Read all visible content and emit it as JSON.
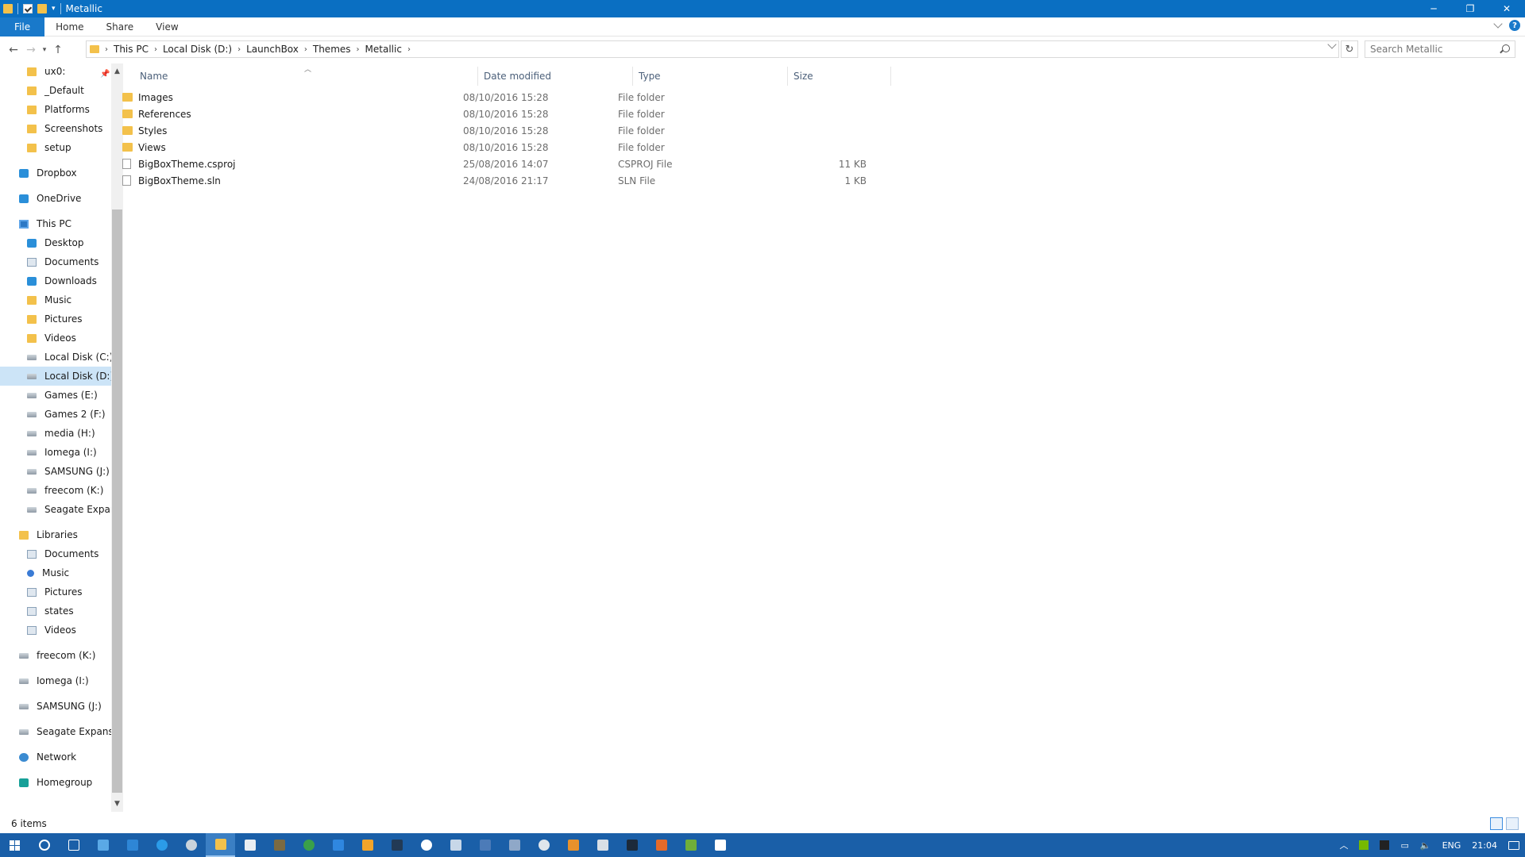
{
  "window": {
    "title": "Metallic",
    "controls": {
      "minimize": "─",
      "restore": "❐",
      "close": "✕"
    }
  },
  "ribbon": {
    "tabs": [
      {
        "label": "File"
      },
      {
        "label": "Home"
      },
      {
        "label": "Share"
      },
      {
        "label": "View"
      }
    ],
    "help": "?"
  },
  "address": {
    "crumbs": [
      "This PC",
      "Local Disk (D:)",
      "LaunchBox",
      "Themes",
      "Metallic"
    ]
  },
  "search": {
    "placeholder": "Search Metallic"
  },
  "nav": {
    "quick_access": [
      "ux0:",
      "_Default",
      "Platforms",
      "Screenshots",
      "setup"
    ],
    "dropbox": "Dropbox",
    "onedrive": "OneDrive",
    "this_pc": "This PC",
    "this_pc_items": [
      "Desktop",
      "Documents",
      "Downloads",
      "Music",
      "Pictures",
      "Videos",
      "Local Disk (C:)",
      "Local Disk (D:)",
      "Games (E:)",
      "Games 2 (F:)",
      "media (H:)",
      "Iomega (I:)",
      "SAMSUNG (J:)",
      "freecom (K:)",
      "Seagate Expansion"
    ],
    "libraries": "Libraries",
    "library_items": [
      "Documents",
      "Music",
      "Pictures",
      "states",
      "Videos"
    ],
    "drives": [
      "freecom (K:)",
      "Iomega (I:)",
      "SAMSUNG (J:)",
      "Seagate Expansion"
    ],
    "network": "Network",
    "homegroup": "Homegroup"
  },
  "columns": {
    "name": "Name",
    "date": "Date modified",
    "type": "Type",
    "size": "Size"
  },
  "files": [
    {
      "name": "Images",
      "date": "08/10/2016 15:28",
      "type": "File folder",
      "size": "",
      "kind": "folder"
    },
    {
      "name": "References",
      "date": "08/10/2016 15:28",
      "type": "File folder",
      "size": "",
      "kind": "folder"
    },
    {
      "name": "Styles",
      "date": "08/10/2016 15:28",
      "type": "File folder",
      "size": "",
      "kind": "folder"
    },
    {
      "name": "Views",
      "date": "08/10/2016 15:28",
      "type": "File folder",
      "size": "",
      "kind": "folder"
    },
    {
      "name": "BigBoxTheme.csproj",
      "date": "25/08/2016 14:07",
      "type": "CSPROJ File",
      "size": "11 KB",
      "kind": "file"
    },
    {
      "name": "BigBoxTheme.sln",
      "date": "24/08/2016 21:17",
      "type": "SLN File",
      "size": "1 KB",
      "kind": "file"
    }
  ],
  "status": {
    "count": "6 items"
  },
  "taskbar": {
    "language": "ENG",
    "time": "21:04",
    "apps": [
      "cortana-icon",
      "task-view-icon",
      "app-icon",
      "app-icon",
      "edge-icon",
      "steam-icon",
      "file-explorer-icon",
      "store-icon",
      "app-icon",
      "app-icon",
      "app-icon",
      "app-icon",
      "app-icon",
      "xbox-icon",
      "app-icon",
      "app-icon",
      "app-icon",
      "app-icon",
      "app-icon",
      "app-icon",
      "app-icon",
      "app-icon",
      "app-icon",
      "app-icon"
    ]
  }
}
